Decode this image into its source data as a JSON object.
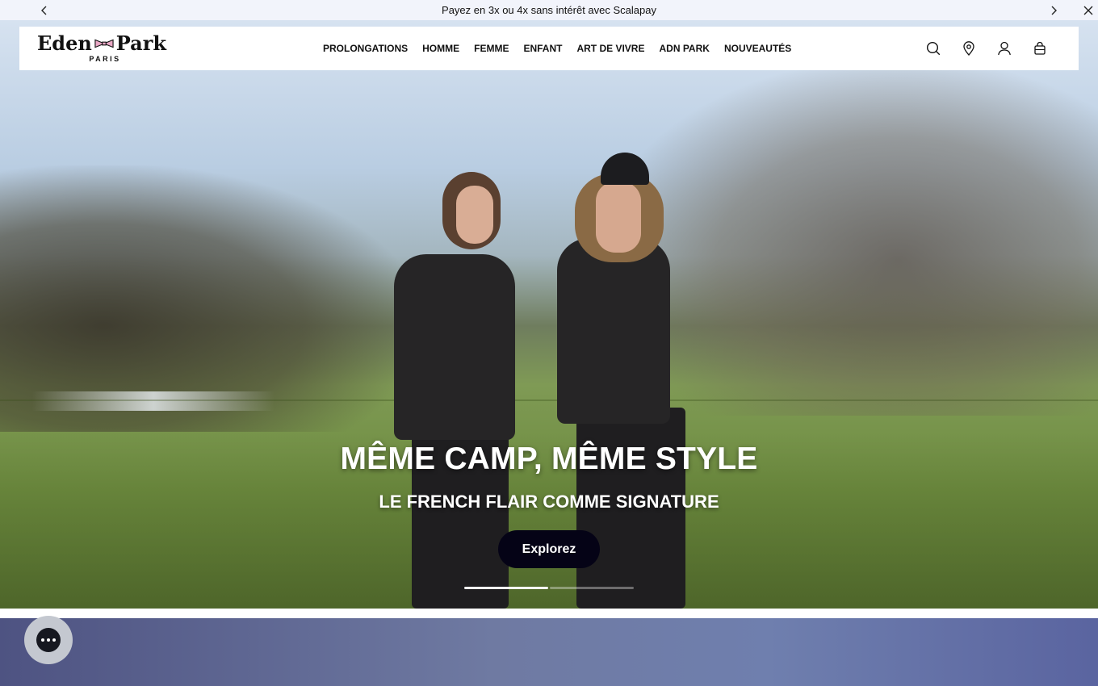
{
  "announcement": {
    "text": "Payez en 3x ou 4x sans intérêt avec Scalapay",
    "prev_icon": "chevron-left-icon",
    "next_icon": "chevron-right-icon",
    "close_icon": "close-icon"
  },
  "header": {
    "logo": {
      "left": "Eden",
      "right": "Park",
      "sub": "PARIS"
    },
    "nav": [
      "PROLONGATIONS",
      "HOMME",
      "FEMME",
      "ENFANT",
      "ART DE VIVRE",
      "ADN PARK",
      "NOUVEAUTÉS"
    ],
    "icons": [
      "search-icon",
      "store-locator-icon",
      "account-icon",
      "cart-icon"
    ]
  },
  "hero": {
    "title": "MÊME CAMP, MÊME STYLE",
    "subtitle": "LE FRENCH FLAIR COMME SIGNATURE",
    "cta": "Explorez",
    "slides": {
      "count": 2,
      "active": 1
    }
  },
  "colors": {
    "cta_bg": "#050316",
    "announcement_bg": "#f2f4fb",
    "bow_pink": "#e8a7c4",
    "next_section": "#6f7aa2"
  },
  "chat": {
    "icon": "chat-icon"
  }
}
